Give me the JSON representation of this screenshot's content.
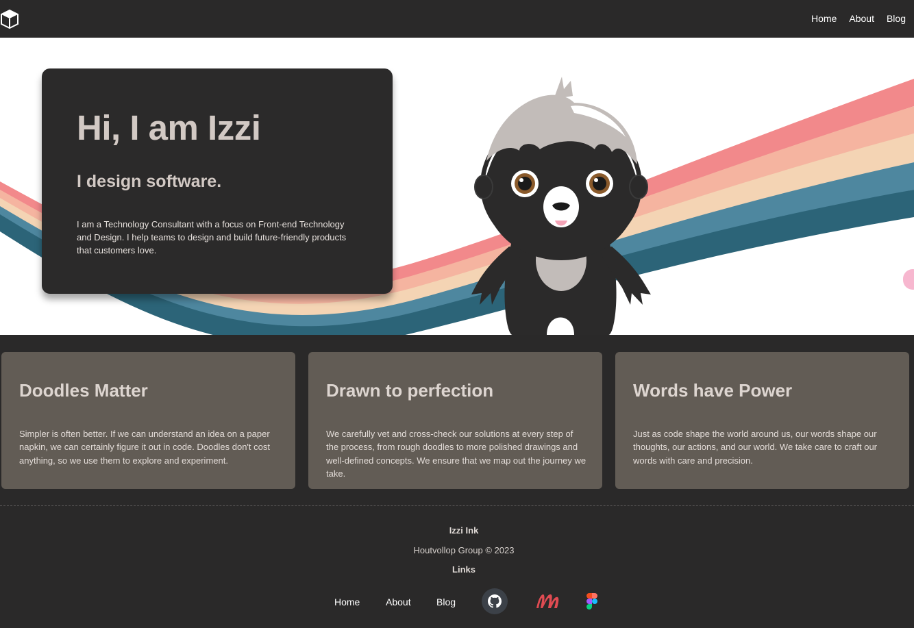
{
  "nav": {
    "logo_icon": "cube-logo-icon",
    "items": [
      "Home",
      "About",
      "Blog"
    ]
  },
  "hero": {
    "title": "Hi, I am Izzi",
    "subtitle": "I design software.",
    "text": "I am a Technology Consultant with a focus on Front-end Technology and Design. I help teams to design and build future-friendly products that customers love.",
    "mascot": "sloth-mascot-illustration",
    "wave_colors": [
      "#f2898b",
      "#f5b4a0",
      "#f4d4b4",
      "#4e879f",
      "#2c6478"
    ]
  },
  "cards": [
    {
      "title": "Doodles Matter",
      "text": "Simpler is often better. If we can understand an idea on a paper napkin, we can certainly figure it out in code. Doodles don't cost anything, so we use them to explore and experiment."
    },
    {
      "title": "Drawn to perfection",
      "text": "We carefully vet and cross-check our solutions at every step of the process, from rough doodles to more polished drawings and well-defined concepts. We ensure that we map out the journey we take."
    },
    {
      "title": "Words have Power",
      "text": "Just as code shape the world around us, our words shape our thoughts, our actions, and our world. We take care to craft our words with care and precision."
    }
  ],
  "footer": {
    "brand": "Izzi Ink",
    "copyright": "Houtvollop Group © 2023",
    "links_title": "Links",
    "links": [
      "Home",
      "About",
      "Blog"
    ],
    "icons": [
      "github-icon",
      "m-brand-icon",
      "figma-icon"
    ]
  },
  "colors": {
    "background": "#2a2929",
    "card_bg": "#625c55",
    "hero_card_bg": "#2b2a2a",
    "text_light": "#d2c9c4"
  }
}
